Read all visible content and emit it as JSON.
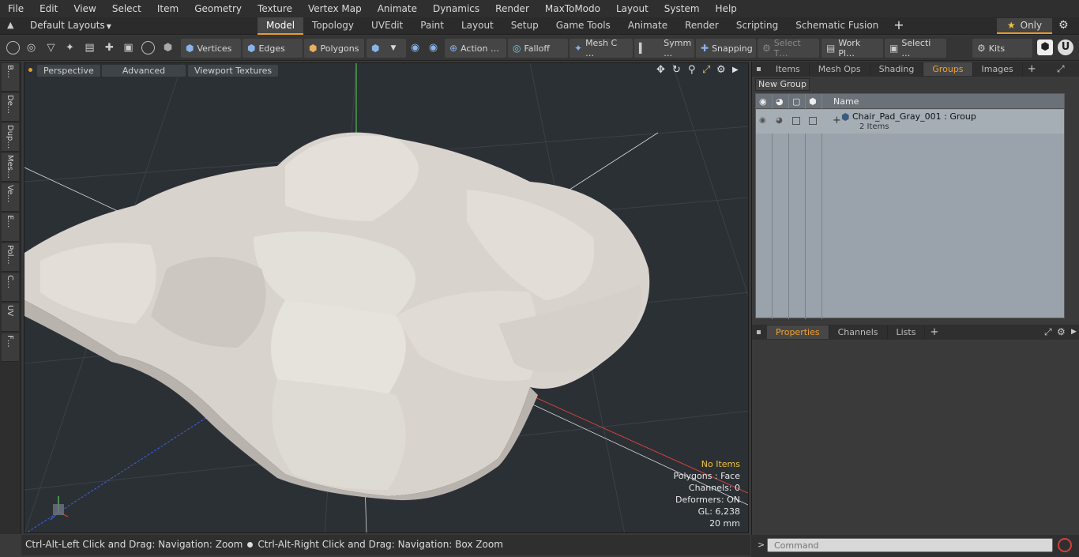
{
  "menu": [
    "File",
    "Edit",
    "View",
    "Select",
    "Item",
    "Geometry",
    "Texture",
    "Vertex Map",
    "Animate",
    "Dynamics",
    "Render",
    "MaxToModo",
    "Layout",
    "System",
    "Help"
  ],
  "layout_dropdown": "Default Layouts",
  "tabs": [
    {
      "label": "Model",
      "active": true
    },
    {
      "label": "Topology",
      "active": false
    },
    {
      "label": "UVEdit",
      "active": false
    },
    {
      "label": "Paint",
      "active": false
    },
    {
      "label": "Layout",
      "active": false
    },
    {
      "label": "Setup",
      "active": false
    },
    {
      "label": "Game Tools",
      "active": false
    },
    {
      "label": "Animate",
      "active": false
    },
    {
      "label": "Render",
      "active": false
    },
    {
      "label": "Scripting",
      "active": false
    },
    {
      "label": "Schematic Fusion",
      "active": false
    }
  ],
  "only_label": "Only",
  "toolbar": {
    "vertices": "Vertices",
    "edges": "Edges",
    "polygons": "Polygons",
    "action": "Action …",
    "falloff": "Falloff",
    "mesh": "Mesh C …",
    "symm": "Symm …",
    "snapping": "Snapping",
    "select_t": "Select T…",
    "work_pl": "Work Pl…",
    "selecti": "Selecti …",
    "kits": "Kits"
  },
  "left_tabs": [
    "B…",
    "De…",
    "Dup…",
    "Mes…",
    "Ve…",
    "E…",
    "Pol…",
    "C…",
    "UV",
    "F…"
  ],
  "viewport": {
    "perspective": "Perspective",
    "advanced": "Advanced",
    "viewport_textures": "Viewport Textures",
    "info": {
      "items": "No Items",
      "polygons": "Polygons : Face",
      "channels": "Channels: 0",
      "deformers": "Deformers: ON",
      "gl": "GL: 6,238",
      "unit": "20 mm"
    }
  },
  "status": {
    "left": "Ctrl-Alt-Left Click and Drag: Navigation: Zoom",
    "right": "Ctrl-Alt-Right Click and Drag: Navigation: Box Zoom"
  },
  "right_tabs": [
    {
      "label": "Items",
      "active": false
    },
    {
      "label": "Mesh Ops",
      "active": false
    },
    {
      "label": "Shading",
      "active": false
    },
    {
      "label": "Groups",
      "active": true
    },
    {
      "label": "Images",
      "active": false
    }
  ],
  "new_group": "New Group",
  "groups_header_name": "Name",
  "group_row": {
    "name": "Chair_Pad_Gray_001 : Group",
    "items": "2 Items"
  },
  "prop_tabs": [
    {
      "label": "Properties",
      "active": true
    },
    {
      "label": "Channels",
      "active": false
    },
    {
      "label": "Lists",
      "active": false
    }
  ],
  "command_placeholder": "Command",
  "colors": {
    "accent": "#e89a2a",
    "viewport_bg": "#2b3035",
    "cushion": "#d8d3cd"
  }
}
